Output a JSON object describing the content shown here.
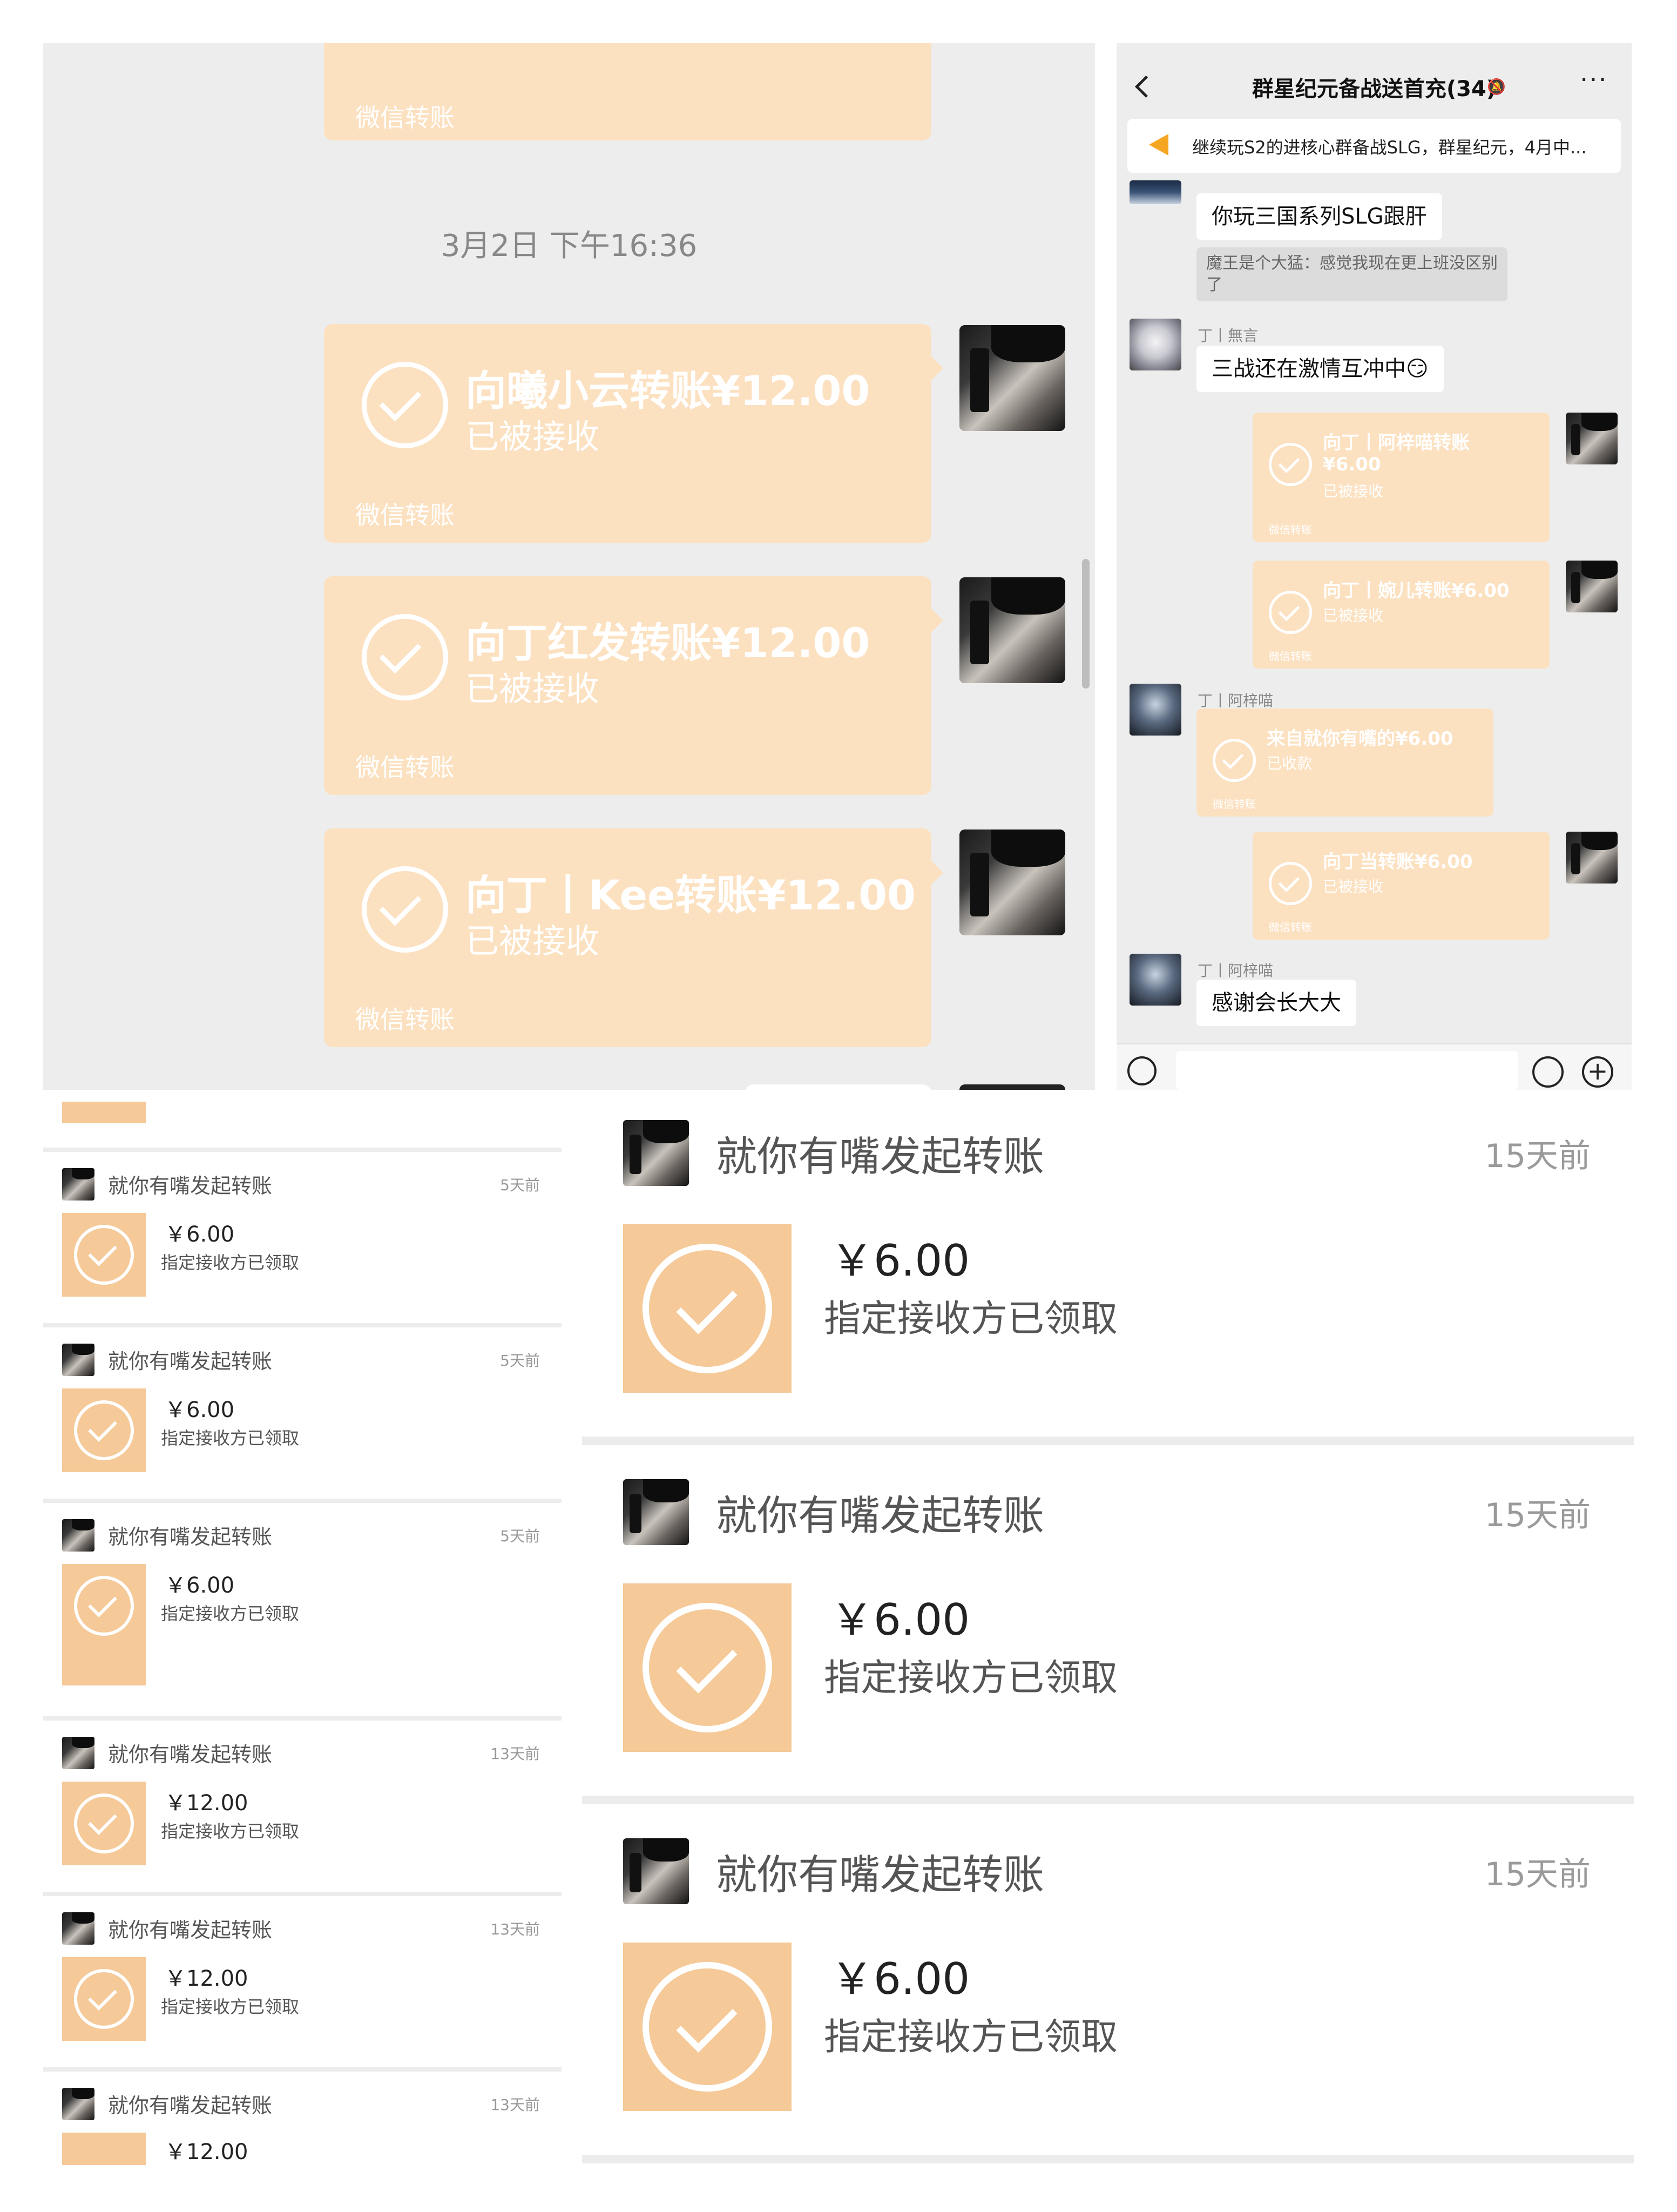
{
  "chat_a": {
    "prev_bubble_label": "微信转账",
    "timestamp": "3月2日 下午16:36",
    "bubbles": [
      {
        "title": "向曦小云转账¥12.00",
        "status": "已被接收",
        "label": "微信转账"
      },
      {
        "title": "向丁红发转账¥12.00",
        "status": "已被接收",
        "label": "微信转账"
      },
      {
        "title": "向丁丨Kee转账¥12.00",
        "status": "已被接收",
        "label": "微信转账"
      }
    ]
  },
  "chat_b": {
    "title": "群星纪元备战送首充(34)",
    "notice": "继续玩S2的进核心群备战SLG，群星纪元，4月中...",
    "messages": {
      "m1_text": "你玩三国系列SLG跟肝",
      "m1_quote": "魔王是个大猛：感觉我现在更上班没区别了",
      "m2_nick": "丁丨無言",
      "m2_text": "三战还在激情互冲中😏",
      "t1_line1": "向丁丨阿梓喵转账",
      "t1_line2": "¥6.00",
      "t1_status": "已被接收",
      "t1_label": "微信转账",
      "t2_line1": "向丁丨婉儿转账¥6.00",
      "t2_status": "已被接收",
      "t2_label": "微信转账",
      "m3_nick": "丁丨阿梓喵",
      "t3_line1": "来自就你有嘴的¥6.00",
      "t3_status": "已收款",
      "t3_label": "微信转账",
      "t4_line1": "向丁当转账¥6.00",
      "t4_status": "已被接收",
      "t4_label": "微信转账",
      "m4_nick": "丁丨阿梓喵",
      "m4_text": "感谢会长大大"
    }
  },
  "list_small": {
    "items": [
      {
        "title": "就你有嘴发起转账",
        "time": "5天前",
        "amount": "￥6.00",
        "status": "指定接收方已领取"
      },
      {
        "title": "就你有嘴发起转账",
        "time": "5天前",
        "amount": "￥6.00",
        "status": "指定接收方已领取"
      },
      {
        "title": "就你有嘴发起转账",
        "time": "5天前",
        "amount": "￥6.00",
        "status": "指定接收方已领取"
      },
      {
        "title": "就你有嘴发起转账",
        "time": "13天前",
        "amount": "￥12.00",
        "status": "指定接收方已领取"
      },
      {
        "title": "就你有嘴发起转账",
        "time": "13天前",
        "amount": "￥12.00",
        "status": "指定接收方已领取"
      },
      {
        "title": "就你有嘴发起转账",
        "time": "13天前",
        "amount": "￥12.00",
        "status": ""
      }
    ]
  },
  "list_large": {
    "items": [
      {
        "title": "就你有嘴发起转账",
        "time": "15天前",
        "amount": "￥6.00",
        "status": "指定接收方已领取"
      },
      {
        "title": "就你有嘴发起转账",
        "time": "15天前",
        "amount": "￥6.00",
        "status": "指定接收方已领取"
      },
      {
        "title": "就你有嘴发起转账",
        "time": "15天前",
        "amount": "￥6.00",
        "status": "指定接收方已领取"
      }
    ]
  },
  "colors": {
    "transfer_bg": "#fce1c1",
    "transfer_box": "#f5c998",
    "chat_bg": "#ededed"
  }
}
